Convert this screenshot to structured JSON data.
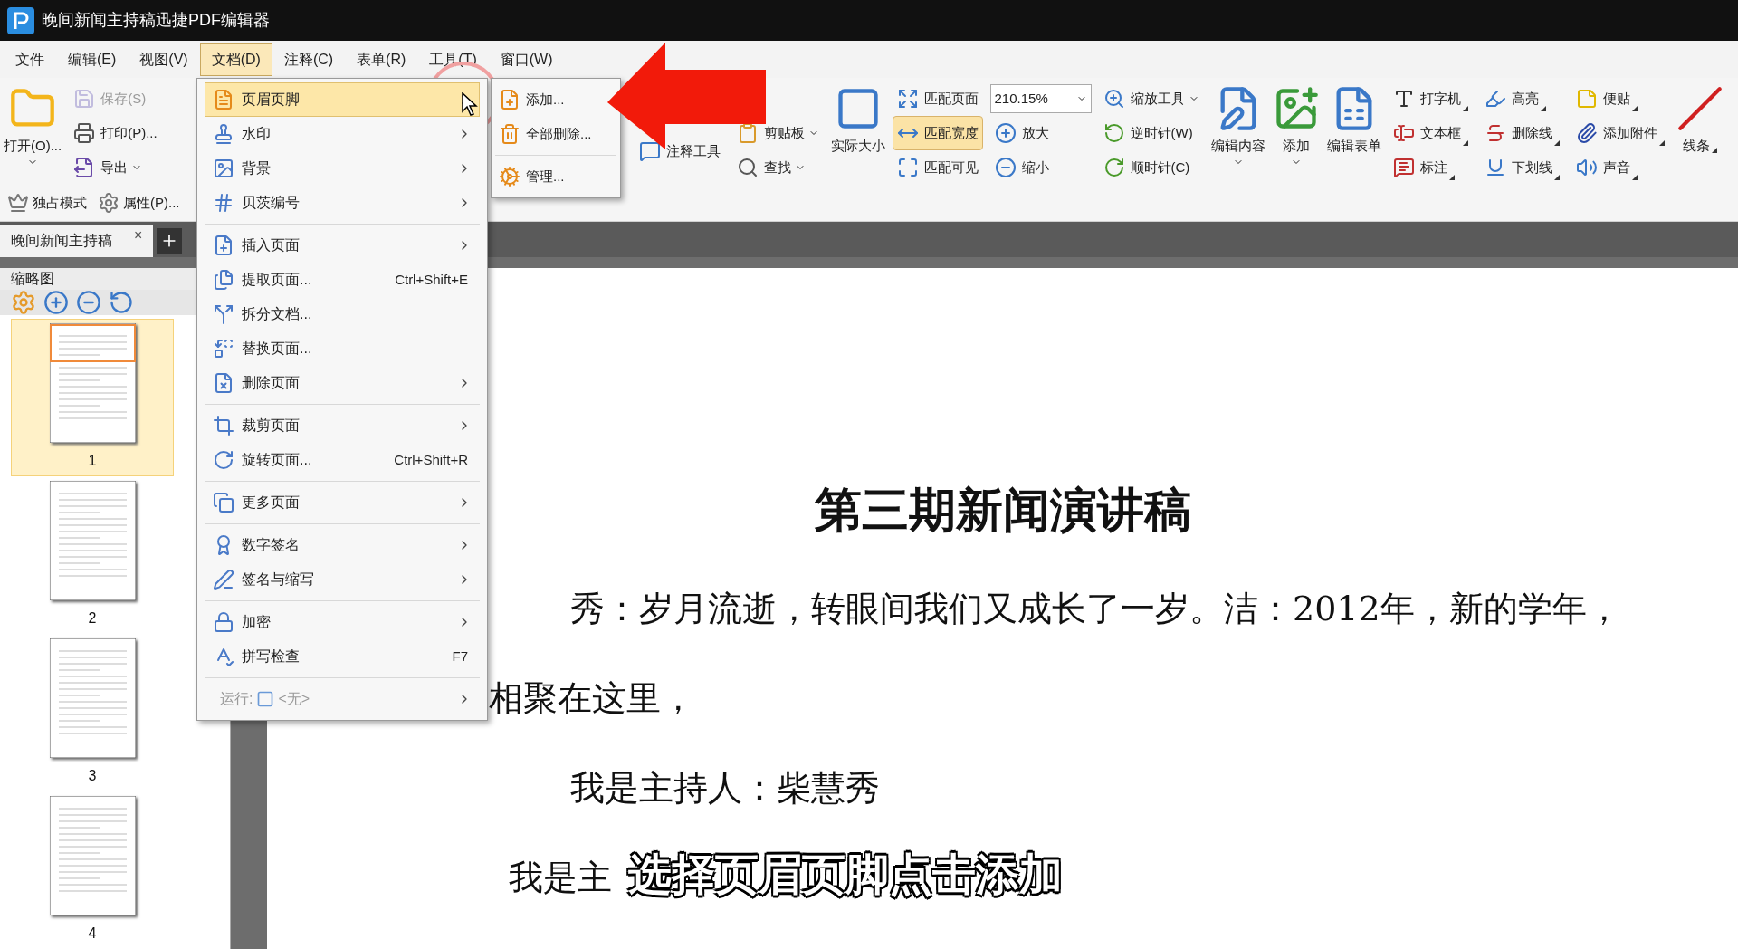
{
  "window": {
    "title": "晚间新闻主持稿迅捷PDF编辑器"
  },
  "menu_bar": [
    {
      "label": "文件",
      "selected": false
    },
    {
      "label": "编辑(E)",
      "selected": false
    },
    {
      "label": "视图(V)",
      "selected": false
    },
    {
      "label": "文档(D)",
      "selected": true
    },
    {
      "label": "注释(C)",
      "selected": false
    },
    {
      "label": "表单(R)",
      "selected": false
    },
    {
      "label": "工具(T)",
      "selected": false
    },
    {
      "label": "窗口(W)",
      "selected": false
    }
  ],
  "toolbar": {
    "groups": [
      {
        "kind": "large",
        "label": "打开(O)...",
        "caret": true
      },
      {
        "kind": "stack",
        "items": [
          {
            "label": "保存(S)",
            "disabled": true
          },
          {
            "label": "打印(P)..."
          },
          {
            "label": "导出",
            "caret": true
          }
        ]
      },
      {
        "kind": "stack",
        "items": [
          {
            "label": "注释工具"
          }
        ]
      },
      {
        "kind": "stack",
        "items": [
          {
            "label": "剪贴板",
            "caret": true
          },
          {
            "label": "查找",
            "caret": true
          }
        ]
      },
      {
        "kind": "large",
        "label": "实际大小"
      },
      {
        "kind": "stack",
        "items": [
          {
            "label": "匹配页面",
            "selected": false
          },
          {
            "label": "匹配宽度",
            "selected": true
          },
          {
            "label": "匹配可见",
            "selected": false
          }
        ]
      },
      {
        "kind": "zoom",
        "value": "210.15%",
        "items": [
          {
            "label": "放大"
          },
          {
            "label": "缩小"
          }
        ]
      },
      {
        "kind": "stack",
        "items": [
          {
            "label": "缩放工具",
            "caret": true
          },
          {
            "label": "逆时针(W)"
          },
          {
            "label": "顺时针(C)"
          }
        ]
      },
      {
        "kind": "large",
        "label": "编辑内容",
        "caret": true
      },
      {
        "kind": "large",
        "label": "添加",
        "caret": true
      },
      {
        "kind": "large",
        "label": "编辑表单"
      },
      {
        "kind": "stack",
        "items": [
          {
            "label": "打字机",
            "corner": true
          },
          {
            "label": "文本框",
            "corner": true
          },
          {
            "label": "标注",
            "corner": true
          }
        ]
      },
      {
        "kind": "stack",
        "items": [
          {
            "label": "高亮",
            "corner": true
          },
          {
            "label": "删除线",
            "corner": true
          },
          {
            "label": "下划线",
            "corner": true
          }
        ]
      },
      {
        "kind": "stack",
        "items": [
          {
            "label": "便贴",
            "corner": true
          },
          {
            "label": "添加附件",
            "corner": true
          },
          {
            "label": "声音",
            "corner": true
          }
        ]
      },
      {
        "kind": "large",
        "label": "线条",
        "corner": true
      }
    ],
    "row2": [
      {
        "label": "独占模式"
      },
      {
        "label": "属性(P)..."
      }
    ]
  },
  "tabs": [
    {
      "label": "晚间新闻主持稿",
      "close": "×",
      "selected": true
    }
  ],
  "thumbnail_panel": {
    "title": "缩略图",
    "pages": [
      {
        "number": "1",
        "selected": true
      },
      {
        "number": "2",
        "selected": false
      },
      {
        "number": "3",
        "selected": false
      },
      {
        "number": "4",
        "selected": false
      }
    ]
  },
  "menu": {
    "groups": [
      [
        {
          "label": "页眉页脚",
          "submenu": true,
          "selected": true
        },
        {
          "label": "水印",
          "submenu": true,
          "selected": false
        },
        {
          "label": "背景",
          "submenu": true,
          "selected": false
        },
        {
          "label": "贝茨编号",
          "submenu": true,
          "selected": false
        }
      ],
      [
        {
          "label": "插入页面",
          "submenu": true,
          "selected": false
        },
        {
          "label": "提取页面...",
          "shortcut": "Ctrl+Shift+E",
          "submenu": false,
          "selected": false
        },
        {
          "label": "拆分文档...",
          "submenu": false,
          "selected": false
        },
        {
          "label": "替换页面...",
          "submenu": false,
          "selected": false
        },
        {
          "label": "删除页面",
          "submenu": true,
          "selected": false
        }
      ],
      [
        {
          "label": "裁剪页面",
          "submenu": true,
          "selected": false
        },
        {
          "label": "旋转页面...",
          "shortcut": "Ctrl+Shift+R",
          "submenu": false,
          "selected": false
        }
      ],
      [
        {
          "label": "更多页面",
          "submenu": true,
          "selected": false
        }
      ],
      [
        {
          "label": "数字签名",
          "submenu": true,
          "selected": false
        },
        {
          "label": "签名与缩写",
          "submenu": true,
          "selected": false
        }
      ],
      [
        {
          "label": "加密",
          "submenu": true,
          "selected": false
        },
        {
          "label": "拼写检查",
          "shortcut": "F7",
          "submenu": false,
          "selected": false
        }
      ],
      [
        {
          "kind": "run",
          "label": "运行:",
          "value": "<无>",
          "submenu": true,
          "selected": false,
          "disabled": true
        }
      ]
    ]
  },
  "submenu": {
    "groups": [
      [
        {
          "label": "添加..."
        },
        {
          "label": "全部删除..."
        }
      ],
      [
        {
          "label": "管理..."
        }
      ]
    ]
  },
  "document": {
    "title": "第三期新闻演讲稿",
    "lines": [
      {
        "kind": "indented",
        "text": "秀：岁月流逝，转眼间我们又成长了一岁。洁：2012年，新的学年，"
      },
      {
        "kind": "plain",
        "text": "相聚在这里，"
      },
      {
        "kind": "indented",
        "text": "我是主持人：柴慧秀"
      },
      {
        "kind": "half",
        "text": "我是主"
      }
    ]
  },
  "caption": "选择页眉页脚点击添加"
}
